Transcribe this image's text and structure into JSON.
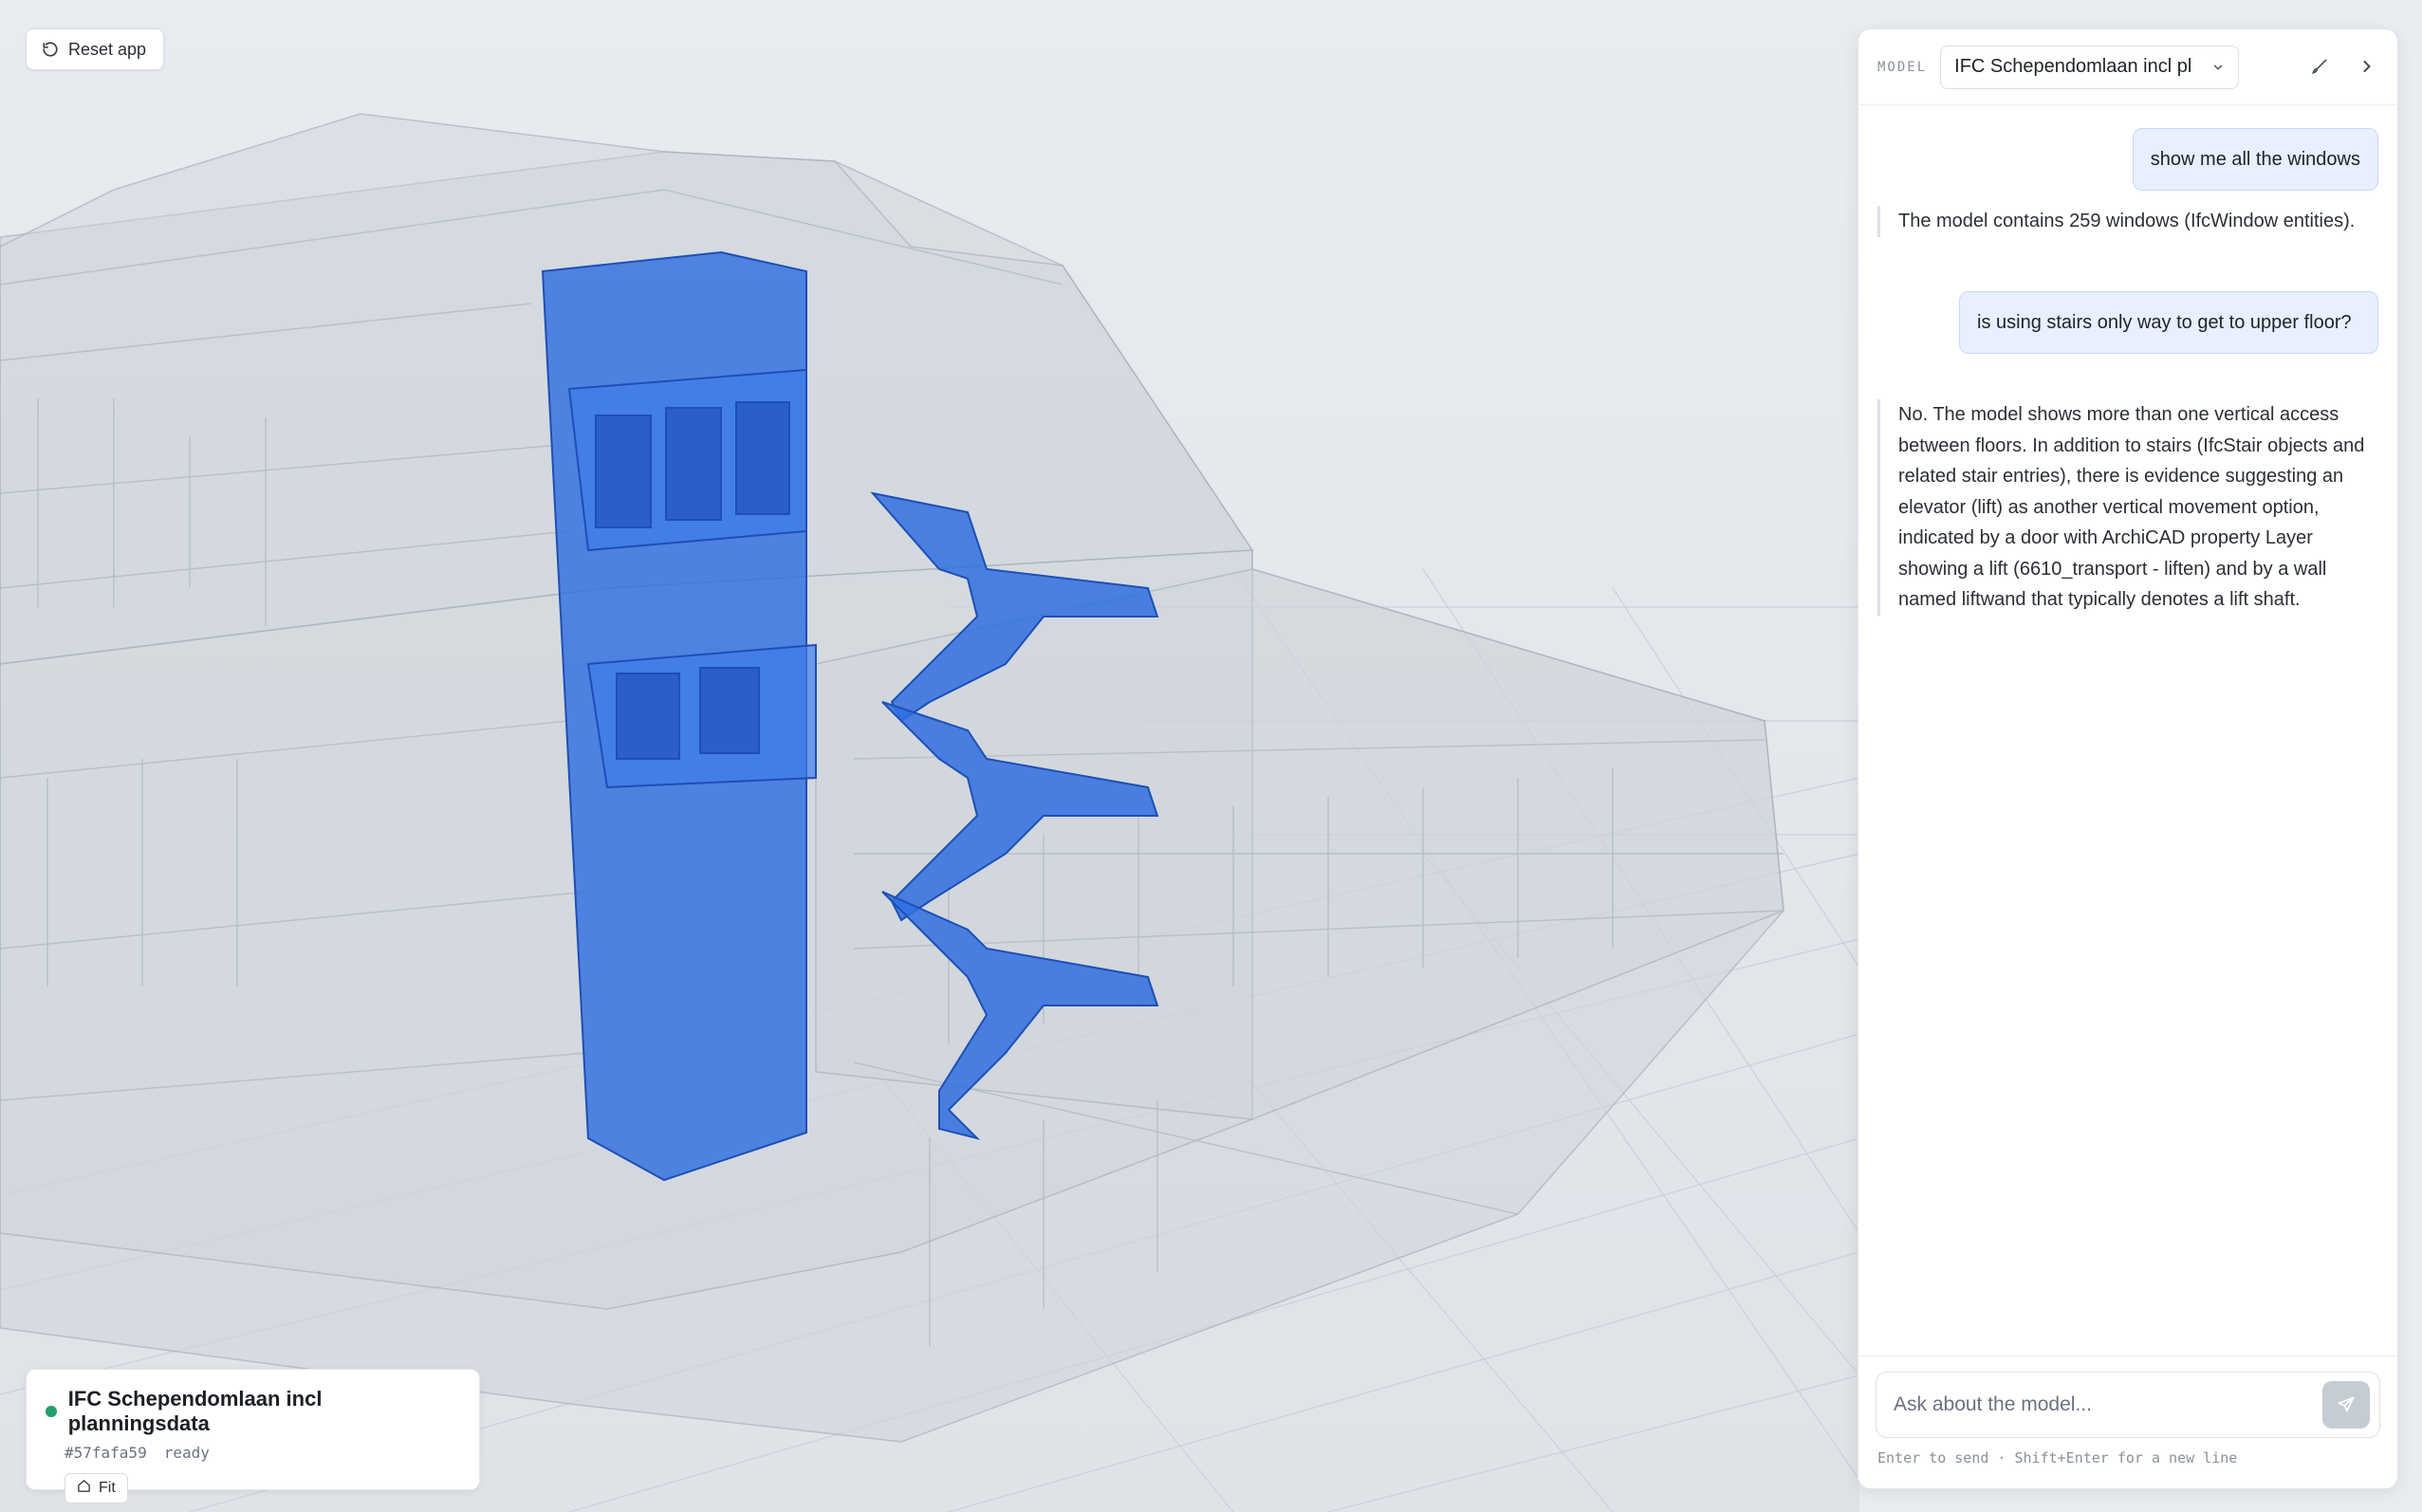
{
  "app": {
    "reset_label": "Reset app"
  },
  "status": {
    "model_name": "IFC Schependomlaan incl planningsdata",
    "hash": "#57fafa59",
    "state": "ready",
    "fit_label": "Fit",
    "state_color": "#22a06b"
  },
  "panel": {
    "model_label": "MODEL",
    "model_value": "IFC Schependomlaan incl pl"
  },
  "messages": [
    {
      "role": "user",
      "text": "show me all the windows"
    },
    {
      "role": "assistant",
      "text": "The model contains 259 windows (IfcWindow entities)."
    },
    {
      "role": "user",
      "text": "is using stairs only way to get to upper floor?"
    },
    {
      "role": "assistant",
      "text": "No. The model shows more than one vertical access between floors. In addition to stairs (IfcStair objects and related stair entries), there is evidence suggesting an elevator (lift) as another vertical movement option, indicated by a door with ArchiCAD property Layer showing a lift (6610_transport - liften) and by a wall named liftwand that typically denotes a lift shaft."
    }
  ],
  "composer": {
    "placeholder": "Ask about the model...",
    "hint": "Enter to send · Shift+Enter for a new line"
  },
  "colors": {
    "highlight": "#2f6fe0",
    "background": "#e9ecf0"
  }
}
